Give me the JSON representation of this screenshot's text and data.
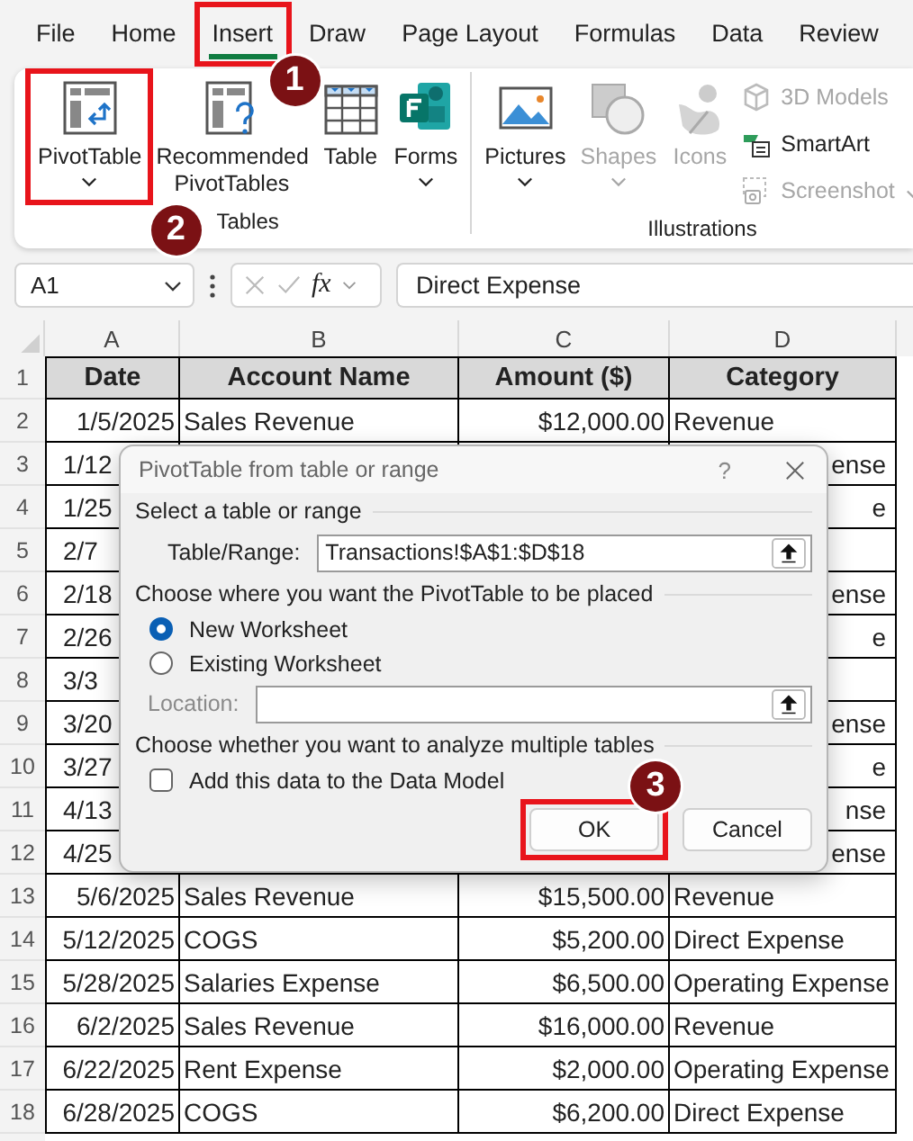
{
  "tabs": [
    {
      "label": "File",
      "selected": false
    },
    {
      "label": "Home",
      "selected": false
    },
    {
      "label": "Insert",
      "selected": true,
      "callout": "1"
    },
    {
      "label": "Draw",
      "selected": false
    },
    {
      "label": "Page Layout",
      "selected": false
    },
    {
      "label": "Formulas",
      "selected": false
    },
    {
      "label": "Data",
      "selected": false
    },
    {
      "label": "Review",
      "selected": false
    }
  ],
  "ribbon": {
    "groups": [
      {
        "label": "Tables",
        "items": [
          {
            "kind": "large",
            "label": "PivotTable",
            "dropdown": true,
            "disabled": false,
            "callout": "2"
          },
          {
            "kind": "large",
            "label": "Recommended PivotTables",
            "dropdown": false,
            "disabled": false
          },
          {
            "kind": "large",
            "label": "Table",
            "dropdown": false,
            "disabled": false
          },
          {
            "kind": "large",
            "label": "Forms",
            "dropdown": true,
            "disabled": false
          }
        ]
      },
      {
        "label": "Illustrations",
        "items": [
          {
            "kind": "large",
            "label": "Pictures",
            "dropdown": true,
            "disabled": false
          },
          {
            "kind": "large",
            "label": "Shapes",
            "dropdown": true,
            "disabled": true
          },
          {
            "kind": "large",
            "label": "Icons",
            "dropdown": false,
            "disabled": true
          },
          {
            "kind": "small",
            "label": "3D Models",
            "dropdown": false,
            "disabled": true
          },
          {
            "kind": "small",
            "label": "SmartArt",
            "dropdown": false,
            "disabled": false
          },
          {
            "kind": "small",
            "label": "Screenshot",
            "dropdown": true,
            "disabled": true
          }
        ]
      }
    ]
  },
  "formula_bar": {
    "name_box": "A1",
    "fx": "fx",
    "formula": "Direct Expense"
  },
  "sheet": {
    "columns": [
      "A",
      "B",
      "C",
      "D"
    ],
    "rows": [
      {
        "number": "1",
        "kind": "header",
        "cells": [
          "Date",
          "Account Name",
          "Amount ($)",
          "Category"
        ]
      },
      {
        "number": "2",
        "kind": "full",
        "cells": [
          "1/5/2025",
          "Sales Revenue",
          "$12,000.00",
          "Revenue"
        ]
      },
      {
        "number": "3",
        "kind": "covered",
        "a": "1/12",
        "d": "ense"
      },
      {
        "number": "4",
        "kind": "covered",
        "a": "1/25",
        "d": "e"
      },
      {
        "number": "5",
        "kind": "covered",
        "a": "2/7"
      },
      {
        "number": "6",
        "kind": "covered",
        "a": "2/18",
        "d": "ense"
      },
      {
        "number": "7",
        "kind": "covered",
        "a": "2/26",
        "d": "e"
      },
      {
        "number": "8",
        "kind": "covered",
        "a": "3/3"
      },
      {
        "number": "9",
        "kind": "covered",
        "a": "3/20",
        "d": "ense"
      },
      {
        "number": "10",
        "kind": "covered",
        "a": "3/27",
        "d": "e"
      },
      {
        "number": "11",
        "kind": "covered",
        "a": "4/13",
        "d": "nse"
      },
      {
        "number": "12",
        "kind": "covered",
        "a": "4/25",
        "d": "ense"
      },
      {
        "number": "13",
        "kind": "full",
        "cells": [
          "5/6/2025",
          "Sales Revenue",
          "$15,500.00",
          "Revenue"
        ]
      },
      {
        "number": "14",
        "kind": "full",
        "cells": [
          "5/12/2025",
          "COGS",
          "$5,200.00",
          "Direct Expense"
        ]
      },
      {
        "number": "15",
        "kind": "full",
        "cells": [
          "5/28/2025",
          "Salaries Expense",
          "$6,500.00",
          "Operating Expense"
        ]
      },
      {
        "number": "16",
        "kind": "full",
        "cells": [
          "6/2/2025",
          "Sales Revenue",
          "$16,000.00",
          "Revenue"
        ]
      },
      {
        "number": "17",
        "kind": "full",
        "cells": [
          "6/22/2025",
          "Rent Expense",
          "$2,000.00",
          "Operating Expense"
        ]
      },
      {
        "number": "18",
        "kind": "full",
        "cells": [
          "6/28/2025",
          "COGS",
          "$6,200.00",
          "Direct Expense"
        ]
      }
    ]
  },
  "dialog": {
    "title": "PivotTable from table or range",
    "help": "?",
    "select_label": "Select a table or range",
    "range_label": "Table/Range:",
    "range_value": "Transactions!$A$1:$D$18",
    "placement_label": "Choose where you want the PivotTable to be placed",
    "options": [
      {
        "label": "New Worksheet",
        "selected": true
      },
      {
        "label": "Existing Worksheet",
        "selected": false
      }
    ],
    "location": {
      "label": "Location:",
      "disabled": true
    },
    "multiple_label": "Choose whether you want to analyze multiple tables",
    "data_model": {
      "label": "Add this data to the Data Model",
      "checked": false
    },
    "buttons": [
      {
        "label": "OK",
        "callout": "3"
      },
      {
        "label": "Cancel"
      }
    ]
  }
}
